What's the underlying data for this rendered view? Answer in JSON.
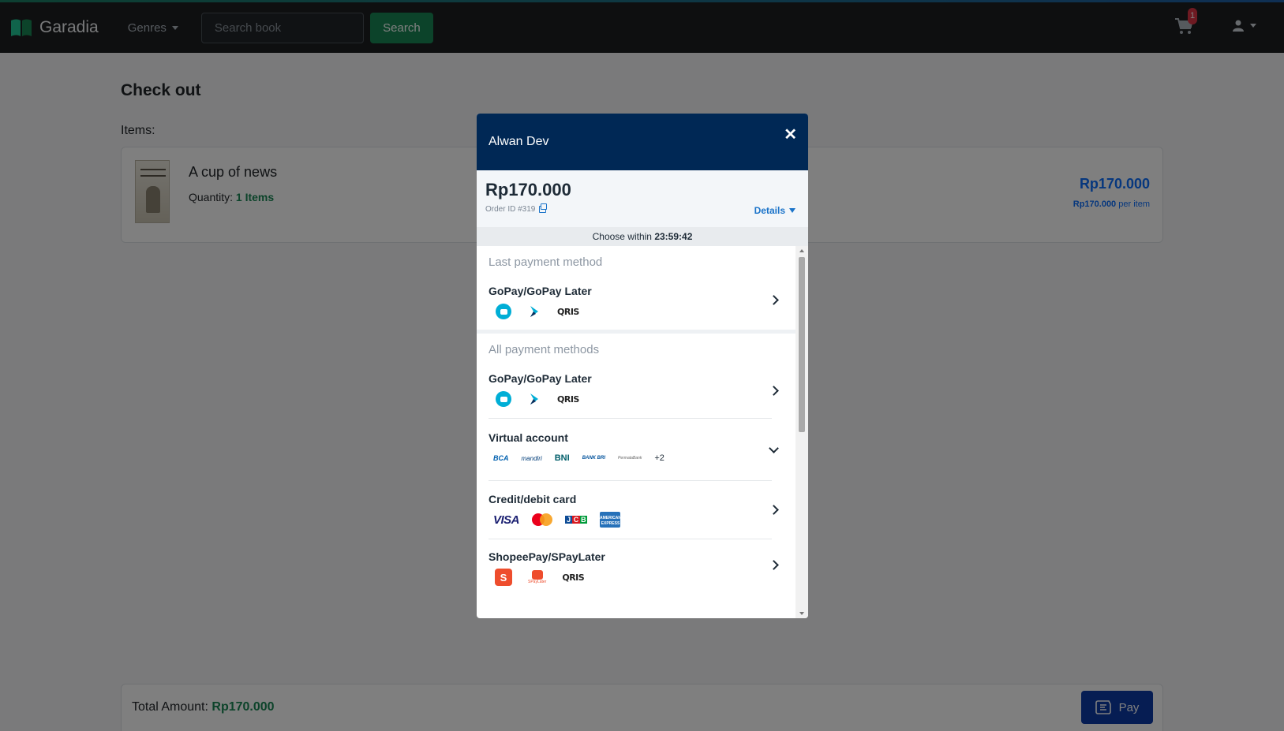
{
  "navbar": {
    "brand": "Garadia",
    "genres_label": "Genres",
    "search_placeholder": "Search book",
    "search_button": "Search",
    "cart_count": "1"
  },
  "checkout": {
    "title": "Check out",
    "items_label": "Items:",
    "item": {
      "name": "A cup of news",
      "quantity_label": "Quantity:",
      "quantity_value": "1 Items",
      "price": "Rp170.000",
      "unit_price": "Rp170.000",
      "unit_suffix": "per item"
    },
    "total_label": "Total Amount:",
    "total_value": "Rp170.000",
    "pay_button": "Pay"
  },
  "modal": {
    "merchant": "Alwan Dev",
    "close_symbol": "✕",
    "amount": "Rp170.000",
    "order_id": "Order ID #319",
    "details_label": "Details",
    "timer_label": "Choose within",
    "timer_value": "23:59:42",
    "last_section": "Last payment method",
    "all_section": "All payment methods",
    "last_method": {
      "name": "GoPay/GoPay Later",
      "logos": [
        "gopay-icon",
        "gopaylater-icon",
        "qris-logo"
      ]
    },
    "methods": [
      {
        "name": "GoPay/GoPay Later",
        "logos": [
          "gopay-icon",
          "gopaylater-icon",
          "qris-logo"
        ],
        "chevron": "right"
      },
      {
        "name": "Virtual account",
        "logos": [
          "BCA",
          "mandiri",
          "BNI",
          "BANK BRI",
          "PermataBank"
        ],
        "more": "+2",
        "chevron": "down"
      },
      {
        "name": "Credit/debit card",
        "logos": [
          "VISA",
          "mastercard",
          "JCB",
          "AMERICAN EXPRESS"
        ],
        "chevron": "right"
      },
      {
        "name": "ShopeePay/SPayLater",
        "logos": [
          "shopeepay-icon",
          "SPayLater",
          "qris-logo"
        ],
        "chevron": "right"
      }
    ],
    "logo_text": {
      "qris": "QRIS",
      "bca": "BCA",
      "mandiri": "mandiri",
      "bni": "BNI",
      "bri": "BANK BRI",
      "permata": "PermataBank",
      "visa": "VISA",
      "jcb": [
        "J",
        "C",
        "B"
      ],
      "amex": "AMERICAN EXPRESS",
      "shopee": "S",
      "spaylater": "SPayLater"
    }
  },
  "colors": {
    "navbar_bg": "#1c1e21",
    "success": "#198754",
    "primary": "#0d6efd",
    "modal_header": "#002855",
    "pay_button": "#0d3aa6",
    "gopay": "#00aed6",
    "shopee": "#ee4d2d"
  }
}
